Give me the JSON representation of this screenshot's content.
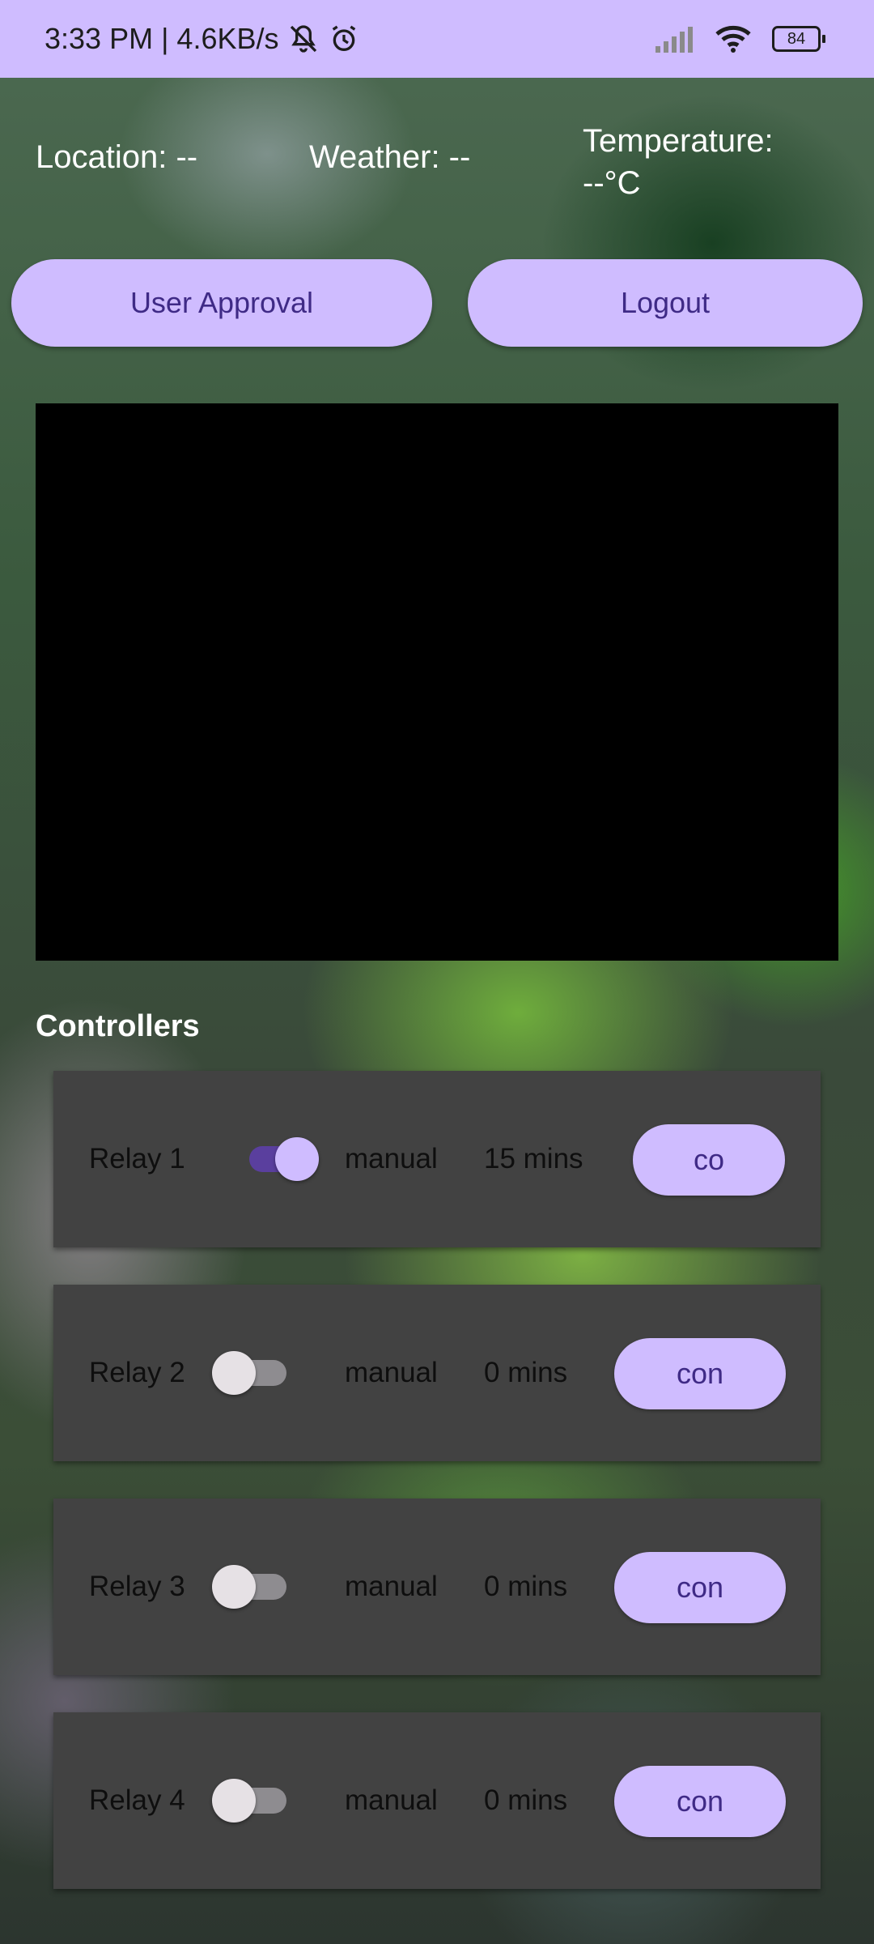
{
  "status_bar": {
    "time_speed": "3:33 PM | 4.6KB/s",
    "battery": "84",
    "icons": [
      "mute-bell-icon",
      "alarm-icon",
      "signal-icon",
      "wifi-icon",
      "battery-icon"
    ]
  },
  "info": {
    "location": "Location: --",
    "weather": "Weather: --",
    "temperature_line1": "Temperature:",
    "temperature_line2": "--°C"
  },
  "buttons": {
    "user_approval": "User Approval",
    "logout": "Logout"
  },
  "controllers": {
    "title": "Controllers",
    "relays": [
      {
        "label": "Relay 1",
        "on": true,
        "mode": "manual",
        "mins": "15 mins",
        "button": "co"
      },
      {
        "label": "Relay 2",
        "on": false,
        "mode": "manual",
        "mins": "0 mins",
        "button": "con"
      },
      {
        "label": "Relay 3",
        "on": false,
        "mode": "manual",
        "mins": "0 mins",
        "button": "con"
      },
      {
        "label": "Relay 4",
        "on": false,
        "mode": "manual",
        "mins": "0 mins",
        "button": "con"
      }
    ]
  },
  "colors": {
    "accent": "#cfbcff",
    "accent_text": "#3f2a86",
    "card": "#424242"
  }
}
